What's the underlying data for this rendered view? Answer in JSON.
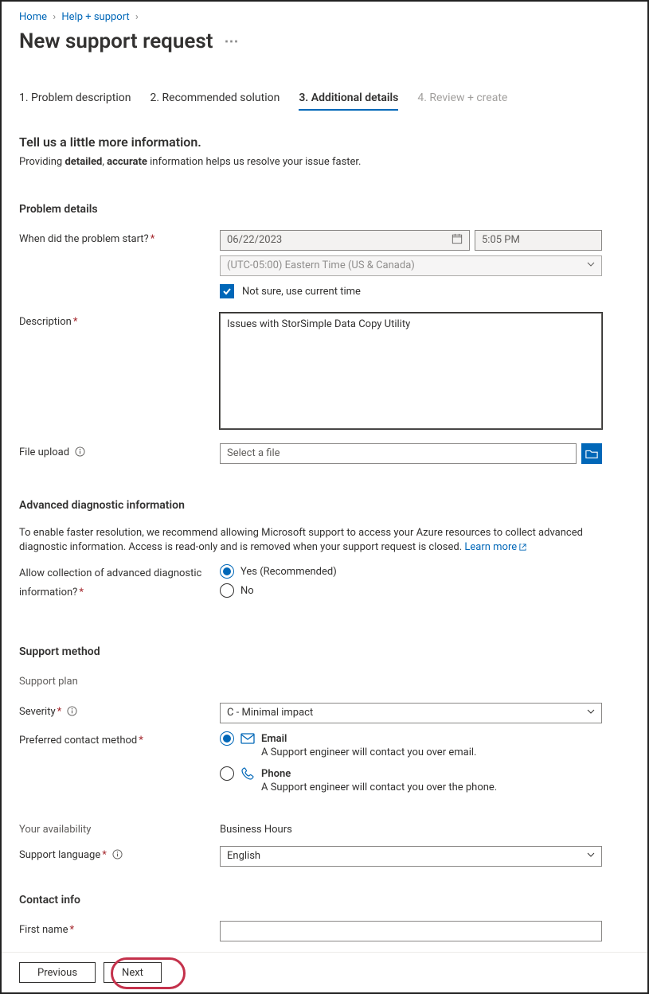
{
  "breadcrumbs": {
    "home": "Home",
    "help": "Help + support"
  },
  "page_title": "New support request",
  "tabs": {
    "t1": "1. Problem description",
    "t2": "2. Recommended solution",
    "t3": "3. Additional details",
    "t4": "4. Review + create"
  },
  "intro": {
    "heading": "Tell us a little more information.",
    "line_pre": "Providing ",
    "line_b1": "detailed",
    "line_mid": ", ",
    "line_b2": "accurate",
    "line_post": " information helps us resolve your issue faster."
  },
  "problem_details": {
    "heading": "Problem details",
    "when_label": "When did the problem start?",
    "date_value": "06/22/2023",
    "time_value": "5:05 PM",
    "tz_value": "(UTC-05:00) Eastern Time (US & Canada)",
    "not_sure_label": "Not sure, use current time",
    "description_label": "Description",
    "description_value": "Issues with StorSimple Data Copy Utility",
    "file_upload_label": "File upload",
    "file_placeholder": "Select a file"
  },
  "advanced": {
    "heading": "Advanced diagnostic information",
    "text": "To enable faster resolution, we recommend allowing Microsoft support to access your Azure resources to collect advanced diagnostic information. Access is read-only and is removed when your support request is closed. ",
    "learn_more": "Learn more",
    "allow_label": "Allow collection of advanced diagnostic information?",
    "yes": "Yes (Recommended)",
    "no": "No"
  },
  "support_method": {
    "heading": "Support method",
    "plan_label": "Support plan",
    "severity_label": "Severity",
    "severity_value": "C - Minimal impact",
    "pref_label": "Preferred contact method",
    "email_title": "Email",
    "email_desc": "A Support engineer will contact you over email.",
    "phone_title": "Phone",
    "phone_desc": "A Support engineer will contact you over the phone.",
    "avail_label": "Your availability",
    "avail_value": "Business Hours",
    "lang_label": "Support language",
    "lang_value": "English"
  },
  "contact_info": {
    "heading": "Contact info",
    "first_name_label": "First name"
  },
  "footer": {
    "previous": "Previous",
    "next": "Next"
  }
}
